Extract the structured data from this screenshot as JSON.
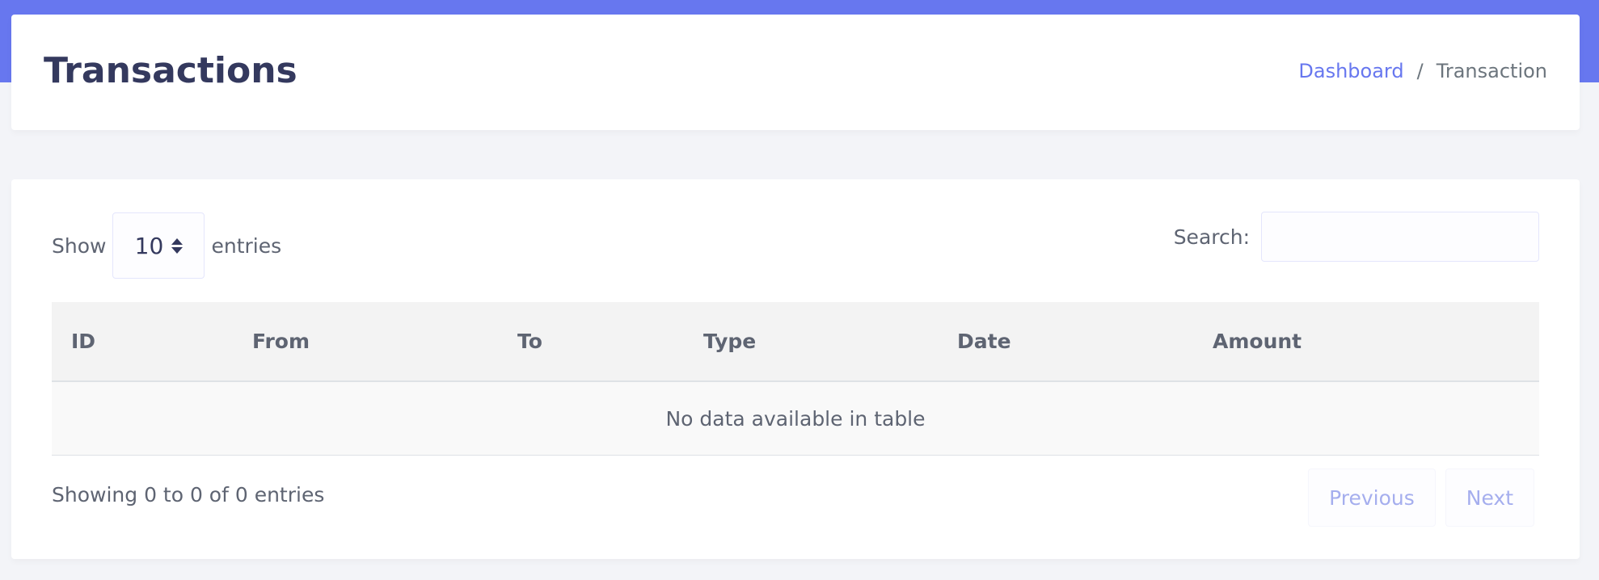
{
  "header": {
    "title": "Transactions",
    "breadcrumb": {
      "dashboard": "Dashboard",
      "separator": "/",
      "current": "Transaction"
    }
  },
  "table_controls": {
    "show_label": "Show",
    "entries_value": "10",
    "entries_label": "entries",
    "search_label": "Search:",
    "search_value": ""
  },
  "table": {
    "columns": [
      "ID",
      "From",
      "To",
      "Type",
      "Date",
      "Amount"
    ],
    "empty_message": "No data available in table"
  },
  "footer": {
    "info": "Showing 0 to 0 of 0 entries",
    "previous": "Previous",
    "next": "Next"
  },
  "colors": {
    "accent": "#6777ef",
    "title": "#34395e",
    "background": "#f3f4f8"
  },
  "icons": {
    "entries_select": "sort-arrows-icon"
  }
}
